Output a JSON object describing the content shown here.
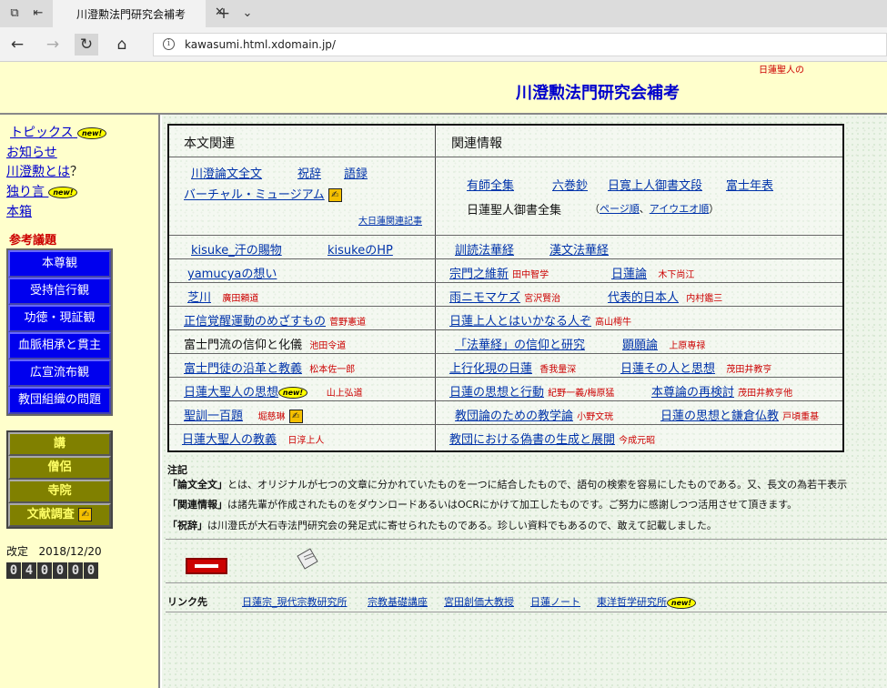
{
  "browser": {
    "tab_title": "川澄勲法門研究会補考",
    "url": "kawasumi.html.xdomain.jp/"
  },
  "header": {
    "title": "川澄勲法門研究会補考",
    "corner_note": "日蓮聖人の"
  },
  "sidebar": {
    "links": [
      "トピックス",
      "お知らせ",
      "川澄勲とは",
      "独り言",
      "本箱"
    ],
    "question_mark": "？",
    "new_badge": "new!",
    "section_heading": "参考議題",
    "blue_menu": [
      "本尊観",
      "受持信行観",
      "功徳・現証観",
      "血脈相承と貫主",
      "広宣流布観",
      "教団組織の問題"
    ],
    "olive_menu": [
      "講",
      "僧侶",
      "寺院",
      "文献調査"
    ],
    "revised_label": "改定",
    "revised_date": "2018/12/20",
    "counter": "040000"
  },
  "table": {
    "left_header": "本文関連",
    "right_header": "関連情報",
    "r1_left": [
      "川澄論文全文",
      "祝辞",
      "語録"
    ],
    "r1_left_b": "バーチャル・ミュージアム",
    "r1_left_sub": "大日蓮関連記事",
    "r1_right": [
      "有師全集",
      "六巻鈔",
      "日寛上人御書文段",
      "富士年表"
    ],
    "r1_right_b": "日蓮聖人御書全集",
    "r1_right_paren_links": [
      "ページ順",
      "アイウエオ順"
    ],
    "rows": [
      {
        "l": "kisuke_汗の賜物",
        "l2": "kisukeのHP",
        "la": "",
        "r": "訓読法華経",
        "r2": "漢文法華経",
        "ra": "",
        "ra2": ""
      },
      {
        "l": "yamucyaの想い",
        "l2": "",
        "la": "",
        "r": "宗門之維新",
        "ra": "田中智学",
        "r2": "日蓮論",
        "ra2": "木下尚江"
      },
      {
        "l": "芝川",
        "l2": "",
        "la": "廣田頼道",
        "r": "雨ニモマケズ",
        "ra": "宮沢賢治",
        "r2": "代表的日本人",
        "ra2": "内村鑑三"
      },
      {
        "l": "正信覚醒運動のめざすもの",
        "l2": "",
        "la": "菅野憲道",
        "r": "日蓮上人とはいかなる人ぞ",
        "ra": "高山樗牛",
        "r2": "",
        "ra2": ""
      },
      {
        "l": "富士門流の信仰と化儀",
        "l2": "",
        "la": "池田令道",
        "r": "「法華経」の信仰と研究",
        "ra": "",
        "r2": "顕願論",
        "ra2": "上原専禄"
      },
      {
        "l": "富士門徒の沿革と教義",
        "l2": "",
        "la": "松本佐一郎",
        "r": "上行化現の日蓮",
        "ra": "香我量深",
        "r2": "日蓮その人と思想",
        "ra2": "茂田井教亨"
      },
      {
        "l": "日蓮大聖人の思想",
        "l2": "",
        "la": "山上弘道",
        "r": "日蓮の思想と行動",
        "ra": "紀野一義/梅原猛",
        "r2": "本尊論の再検討",
        "ra2": "茂田井教亨他"
      },
      {
        "l": "聖訓一百題",
        "l2": "",
        "la": "堀慈琳",
        "r": "教団論のための教学論",
        "ra": "小野文珖",
        "r2": "日蓮の思想と鎌倉仏教",
        "ra2": "戸頃重基"
      },
      {
        "l": "日蓮大聖人の教義",
        "l2": "",
        "la": "日淳上人",
        "r": "教団における偽書の生成と展開",
        "ra": "今成元昭",
        "r2": "",
        "ra2": ""
      }
    ]
  },
  "notes": {
    "heading": "注記",
    "n1_term": "「論文全文」",
    "n1_text": "とは、オリジナルが七つの文章に分かれていたものを一つに結合したもので、語句の検索を容易にしたものである。又、長文の為若干表示",
    "n2_term": "「関連情報」",
    "n2_text": "は諸先輩が作成されたものをダウンロードあるいはOCRにかけて加工したものです。ご努力に感謝しつつ活用させて頂きます。",
    "n3_term": "「祝辞」",
    "n3_text": "は川澄氏が大石寺法門研究会の発足式に寄せられたものである。珍しい資料でもあるので、敢えて記載しました。"
  },
  "links": {
    "label": "リンク先",
    "items": [
      "日蓮宗_現代宗教研究所",
      "宗教基礎講座",
      "宮田創価大教授",
      "日蓮ノート",
      "東洋哲学研究所"
    ]
  }
}
